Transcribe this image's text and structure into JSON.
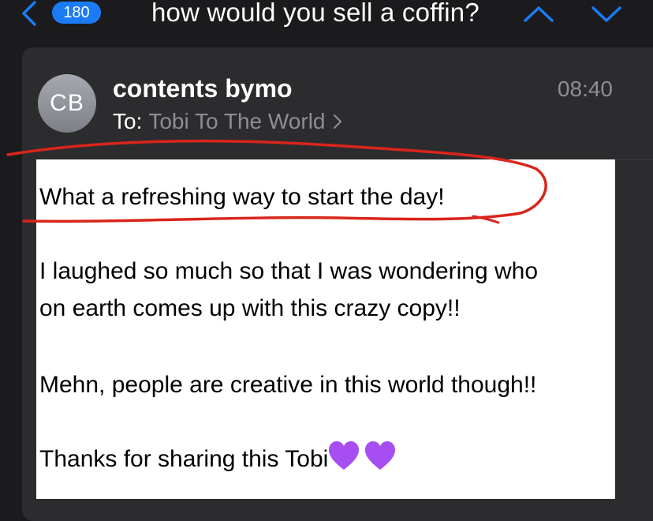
{
  "nav": {
    "unread_count": "180",
    "subject": "how would you sell a coffin?"
  },
  "message": {
    "avatar_initials": "CB",
    "sender": "contents bymo",
    "time": "08:40",
    "to_label": "To:",
    "recipient": "Tobi To The World"
  },
  "body": {
    "lines": [
      "What a refreshing way to start the day!",
      "I laughed so much so that I was wondering who",
      "on earth comes up with this crazy copy!!",
      "Mehn, people are creative in this world though!!",
      "Thanks for sharing this Tobi"
    ],
    "emoji": [
      "purple-heart",
      "purple-heart"
    ]
  },
  "colors": {
    "accent": "#1a7cf5",
    "annotation": "#d9251c",
    "heart": "#a64ef2",
    "background": "#1b1b1d",
    "card": "#2c2c2e",
    "secondary_text": "#8e8e93"
  },
  "icons": [
    "chevron-left-icon",
    "chevron-up-icon",
    "chevron-down-icon",
    "chevron-right-icon",
    "purple-heart-icon"
  ]
}
